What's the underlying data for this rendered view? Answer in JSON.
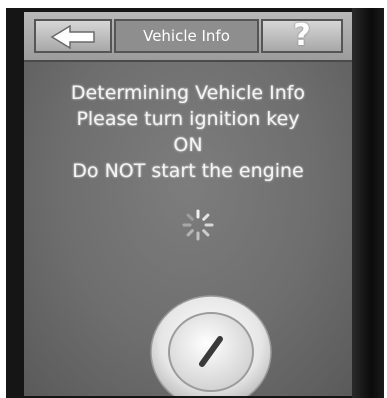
{
  "header": {
    "back_icon": "back-arrow-icon",
    "title": "Vehicle Info",
    "help_label": "?"
  },
  "message": {
    "line1": "Determining Vehicle Info",
    "line2": "Please turn ignition key",
    "line3": "ON",
    "line4": "Do NOT start the engine"
  },
  "status": {
    "spinner_icon": "loading-spinner-icon"
  },
  "graphic": {
    "key_icon": "ignition-key-icon"
  },
  "colors": {
    "screen": "#6e6e6e",
    "header": "#a8a8a8",
    "text": "#f4f4f4",
    "bezel": "#151515"
  }
}
